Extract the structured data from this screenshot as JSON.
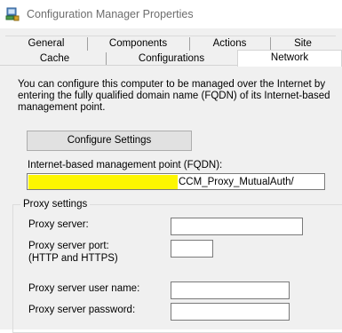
{
  "window": {
    "title": "Configuration Manager Properties",
    "icon": "configuration-manager-icon"
  },
  "tabs": {
    "row1": [
      {
        "id": "general",
        "label": "General"
      },
      {
        "id": "components",
        "label": "Components"
      },
      {
        "id": "actions",
        "label": "Actions"
      },
      {
        "id": "site",
        "label": "Site"
      }
    ],
    "row2": [
      {
        "id": "cache",
        "label": "Cache"
      },
      {
        "id": "configurations",
        "label": "Configurations"
      },
      {
        "id": "network",
        "label": "Network",
        "active": true
      }
    ]
  },
  "network": {
    "description": "You can configure this computer to be managed over the Internet by entering the fully qualified domain name (FQDN) of its Internet-based management point.",
    "configure_button": "Configure Settings",
    "fqdn_label": "Internet-based management point (FQDN):",
    "fqdn_value_visible": "CCM_Proxy_MutualAuth/",
    "fqdn_redaction_color": "#fdf601",
    "proxy": {
      "group_title": "Proxy settings",
      "server_label": "Proxy server:",
      "server_value": "",
      "port_label_line1": "Proxy server port:",
      "port_label_line2": "(HTTP and HTTPS)",
      "port_value": "",
      "username_label": "Proxy server user name:",
      "username_value": "",
      "password_label": "Proxy server password:",
      "password_value": ""
    }
  }
}
